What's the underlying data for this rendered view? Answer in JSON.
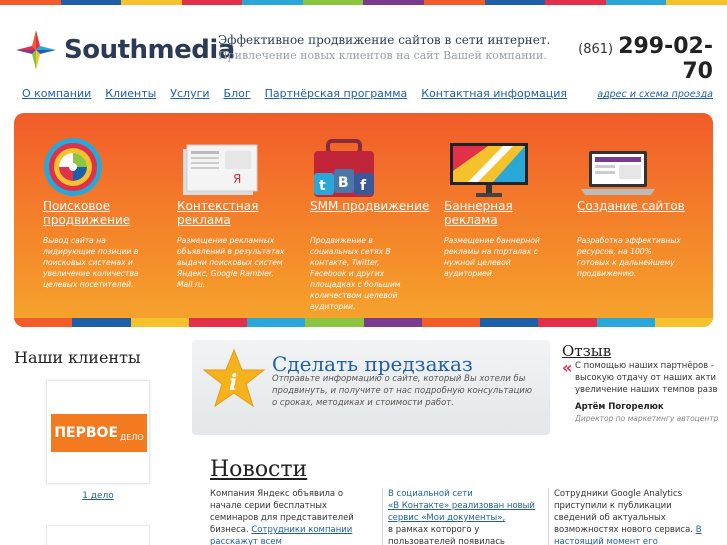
{
  "stripe_colors": [
    "#f25b2a",
    "#1f5fa8",
    "#f6c22c",
    "#e0304a",
    "#2aa7d6",
    "#8bc43f",
    "#7a3b8f",
    "#f25b2a",
    "#1f5fa8",
    "#e0304a",
    "#2aa7d6",
    "#f6c22c"
  ],
  "header": {
    "logo_text": "Southmedia",
    "tagline_1": "Эффективное продвижение сайтов в сети интернет.",
    "tagline_2": "Привлечение новых клиентов на сайт Вашей компании.",
    "phone_code": "(861)",
    "phone_number": "299-02-70",
    "address_link": "адрес и схема проезда"
  },
  "nav": {
    "items": [
      "О компании",
      "Клиенты",
      "Услуги",
      "Блог",
      "Партнёрская программа",
      "Контактная информация"
    ]
  },
  "services": [
    {
      "title": "Поисковое продвижение",
      "desc": "Вывод сайта на лидирующие позиции в поисковых системах и увеличение количества целевых посетителей.",
      "icon": "target-icon"
    },
    {
      "title": "Контекстная реклама",
      "desc": "Размещение рекламных объявлений в результатах выдачи поисковых систем Яндекс, Google Rambler, Mail.ru.",
      "icon": "newspaper-icon"
    },
    {
      "title": "SMM продвижение",
      "desc": "Продвижение в социальных сетях В контакте, Twitter, Facebook и других площадках с большим количеством целевой аудитории.",
      "icon": "social-bag-icon"
    },
    {
      "title": "Баннерная реклама",
      "desc": "Размещение баннерной рекламы на порталах с нужной целевой аудиторией.",
      "icon": "banner-board-icon"
    },
    {
      "title": "Создание сайтов",
      "desc": "Разработка эффективных ресурсов, на 100% готовых к дальнейшему продвижению.",
      "icon": "laptop-icon"
    }
  ],
  "clients": {
    "heading": "Наши клиенты",
    "logo_text": "ПЕРВОЕ",
    "logo_sub": "ДЕЛО",
    "name": "1 дело"
  },
  "preorder": {
    "title": "Сделать предзаказ",
    "desc": "Отправьте информацию о сайте, который Вы хотели бы продвинуть, и получите от нас подробную консультацию о сроках, методиках и стоимости работ."
  },
  "review": {
    "heading": "Отзыв",
    "quote_mark": "«",
    "text_1": "С помощью наших партнёров -",
    "text_2": "высокую отдачу от наших акти",
    "text_3": "увеличение наших темпов разв",
    "author": "Артём Погорелюк",
    "role": "Директор по маркетингу автоцентр"
  },
  "news": {
    "heading": "Новости",
    "col1": {
      "text_1": "Компания Яндекс объявила о начале серии бесплатных семинаров для представителей бизнеса.",
      "link": "Сотрудники компании расскажут всем заинтересованным"
    },
    "col2": {
      "prefix": "В социальной сети",
      "link": "«В Контакте» реализован новый сервис «Мои документы»,",
      "text": "в рамках которого у пользователей появилась"
    },
    "col3": {
      "text_1": "Сотрудники Google Analytics приступили к публикации сведений об актуальных возможностях нового сервиса.",
      "link": "В настоящий момент его"
    }
  }
}
